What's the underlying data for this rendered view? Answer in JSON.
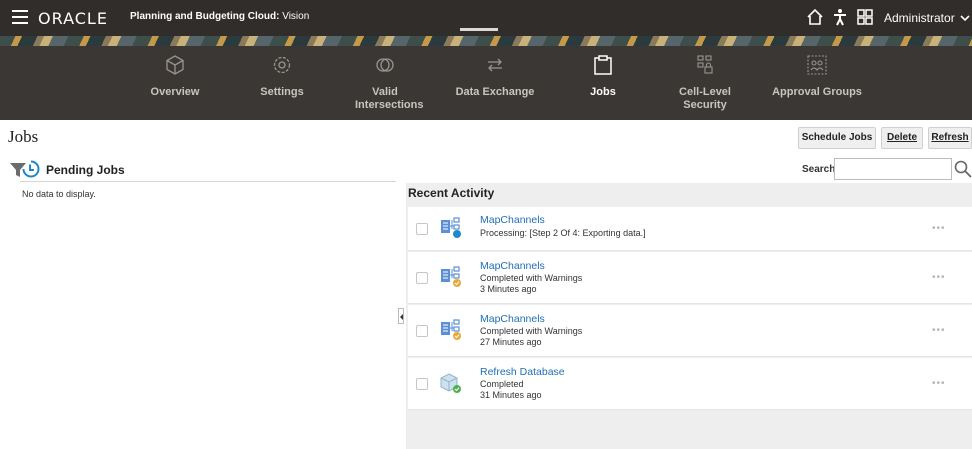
{
  "topbar": {
    "logo": "ORACLE",
    "app_title_bold": "Planning and Budgeting Cloud:",
    "app_title_rest": " Vision",
    "user": "Administrator",
    "icons": [
      "home-icon",
      "accessibility-icon",
      "navigator-grid-icon",
      "chevron-down-icon"
    ]
  },
  "nav": {
    "items": [
      {
        "label": "Overview",
        "icon": "overview-icon"
      },
      {
        "label": "Settings",
        "icon": "settings-gear-icon"
      },
      {
        "label": "Valid Intersections",
        "icon": "valid-intersections-icon"
      },
      {
        "label": "Data Exchange",
        "icon": "data-exchange-icon"
      },
      {
        "label": "Jobs",
        "icon": "jobs-clipboard-icon"
      },
      {
        "label": "Cell-Level Security",
        "icon": "cell-security-icon"
      },
      {
        "label": "Approval Groups",
        "icon": "approval-groups-icon"
      }
    ],
    "active": "Jobs"
  },
  "page": {
    "title": "Jobs",
    "buttons": {
      "schedule": "Schedule Jobs",
      "delete": "Delete",
      "refresh": "Refresh"
    },
    "search_label": "Search",
    "search_value": ""
  },
  "pending": {
    "title": "Pending Jobs",
    "empty": "No data to display."
  },
  "recent": {
    "title": "Recent Activity",
    "rows": [
      {
        "name": "MapChannels",
        "status": "Processing: [Step 2 Of 4: Exporting data.]",
        "time": "",
        "state": "processing"
      },
      {
        "name": "MapChannels",
        "status": "Completed with Warnings",
        "time": "3 Minutes ago",
        "state": "warning"
      },
      {
        "name": "MapChannels",
        "status": "Completed with Warnings",
        "time": "27 Minutes ago",
        "state": "warning"
      },
      {
        "name": "Refresh Database",
        "status": "Completed",
        "time": "31 Minutes ago",
        "state": "completed"
      }
    ],
    "more": "•••"
  },
  "colors": {
    "topbar": "#312d2a",
    "nav": "#3a3734",
    "link": "#1f6fb5",
    "warning": "#e8a93b",
    "success": "#4caf50",
    "processing": "#1e88c9"
  }
}
